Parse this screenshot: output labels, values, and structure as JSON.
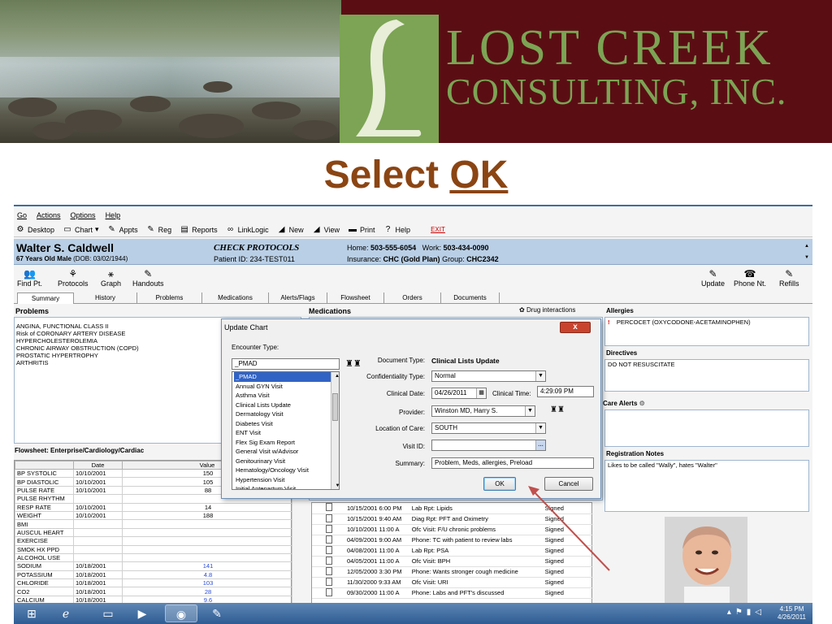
{
  "banner": {
    "brand_line1": "LOST CREEK",
    "brand_line2": "CONSULTING, INC."
  },
  "slide_title": {
    "prefix": "Select ",
    "emphasis": "OK"
  },
  "menu": [
    "Go",
    "Actions",
    "Options",
    "Help"
  ],
  "toolbar": [
    {
      "label": "Desktop",
      "icon": "desktop-icon",
      "glyph": "⚙"
    },
    {
      "label": "Chart",
      "icon": "folder-icon",
      "glyph": "▭"
    },
    {
      "label": "Appts",
      "icon": "calendar-icon",
      "glyph": "✎"
    },
    {
      "label": "Reg",
      "icon": "pen-icon",
      "glyph": "✎"
    },
    {
      "label": "Reports",
      "icon": "reports-icon",
      "glyph": "▤"
    },
    {
      "label": "LinkLogic",
      "icon": "link-icon",
      "glyph": "∞"
    },
    {
      "label": "New",
      "icon": "new-icon",
      "glyph": "◢"
    },
    {
      "label": "View",
      "icon": "view-icon",
      "glyph": "◢"
    },
    {
      "label": "Print",
      "icon": "printer-icon",
      "glyph": "▬"
    },
    {
      "label": "Help",
      "icon": "help-icon",
      "glyph": "?"
    },
    {
      "label": "EXIT",
      "icon": "exit-icon",
      "glyph": ""
    }
  ],
  "patient": {
    "name": "Walter S. Caldwell",
    "age_sex": "67 Years Old Male",
    "dob": "(DOB: 03/02/1944)",
    "check": "CHECK PROTOCOLS",
    "patient_id": "Patient ID: 234-TEST011",
    "home_label": "Home:",
    "home": "503-555-6054",
    "work_label": "Work:",
    "work": "503-434-0090",
    "insurance_label": "Insurance:",
    "insurance": "CHC (Gold Plan)",
    "group_label": "Group:",
    "group": "CHC2342"
  },
  "actions_left": [
    {
      "label": "Find Pt.",
      "icon": "find-patient-icon",
      "glyph": "👥"
    },
    {
      "label": "Protocols",
      "icon": "protocols-icon",
      "glyph": "⚘"
    },
    {
      "label": "Graph",
      "icon": "graph-icon",
      "glyph": "⚹"
    },
    {
      "label": "Handouts",
      "icon": "handouts-icon",
      "glyph": "✎"
    }
  ],
  "actions_right": [
    {
      "label": "Update",
      "icon": "update-icon",
      "glyph": "✎"
    },
    {
      "label": "Phone Nt.",
      "icon": "phone-note-icon",
      "glyph": "☎"
    },
    {
      "label": "Refills",
      "icon": "refills-icon",
      "glyph": "✎"
    }
  ],
  "tabs": [
    "Summary",
    "History",
    "Problems",
    "Medications",
    "Alerts/Flags",
    "Flowsheet",
    "Orders",
    "Documents"
  ],
  "problems": {
    "title": "Problems",
    "items": [
      "ANGINA, FUNCTIONAL CLASS II",
      "Risk of CORONARY ARTERY DISEASE",
      "HYPERCHOLESTEROLEMIA",
      "CHRONIC AIRWAY OBSTRUCTION (COPD)",
      "PROSTATIC HYPERTROPHY",
      "ARTHRITIS"
    ]
  },
  "medications": {
    "title": "Medications",
    "drug_interactions": "Drug interactions"
  },
  "allergies": {
    "title": "Allergies",
    "item": "PERCOCET (OXYCODONE-ACETAMINOPHEN)"
  },
  "directives": {
    "title": "Directives",
    "item": "DO NOT RESUSCITATE"
  },
  "care_alerts": {
    "title": "Care Alerts"
  },
  "registration": {
    "title": "Registration Notes",
    "note": "Likes to be called \"Wally\", hates \"Walter\""
  },
  "flowsheet": {
    "title": "Flowsheet: Enterprise/Cardiology/Cardiac",
    "headers": [
      "",
      "Date",
      "Value"
    ],
    "rows": [
      {
        "name": "BP SYSTOLIC",
        "date": "10/10/2001",
        "value": "150",
        "blue": false
      },
      {
        "name": "BP DIASTOLIC",
        "date": "10/10/2001",
        "value": "105",
        "blue": false
      },
      {
        "name": "PULSE RATE",
        "date": "10/10/2001",
        "value": "88",
        "blue": false
      },
      {
        "name": "PULSE RHYTHM",
        "date": "",
        "value": "",
        "blue": false
      },
      {
        "name": "RESP RATE",
        "date": "10/10/2001",
        "value": "14",
        "blue": false
      },
      {
        "name": "WEIGHT",
        "date": "10/10/2001",
        "value": "188",
        "blue": false
      },
      {
        "name": "BMI",
        "date": "",
        "value": "",
        "blue": false
      },
      {
        "name": "AUSCUL HEART",
        "date": "",
        "value": "",
        "blue": false
      },
      {
        "name": "EXERCISE",
        "date": "",
        "value": "",
        "blue": false
      },
      {
        "name": "SMOK HX PPD",
        "date": "",
        "value": "",
        "blue": false
      },
      {
        "name": "ALCOHOL USE",
        "date": "",
        "value": "",
        "blue": false
      },
      {
        "name": "SODIUM",
        "date": "10/18/2001",
        "value": "141",
        "blue": true
      },
      {
        "name": "POTASSIUM",
        "date": "10/18/2001",
        "value": "4.8",
        "blue": true
      },
      {
        "name": "CHLORIDE",
        "date": "10/18/2001",
        "value": "103",
        "blue": true
      },
      {
        "name": "CO2",
        "date": "10/18/2001",
        "value": "28",
        "blue": true
      },
      {
        "name": "CALCIUM",
        "date": "10/18/2001",
        "value": "9.6",
        "blue": true
      }
    ]
  },
  "encounters": [
    {
      "date": "10/15/2001 6:00 PM",
      "desc": "Lab Rpt: Lipids",
      "status": "Signed"
    },
    {
      "date": "10/15/2001 9:40 AM",
      "desc": "Diag Rpt: PFT and Oximetry",
      "status": "Signed"
    },
    {
      "date": "10/10/2001 11:00 A",
      "desc": "Ofc Visit: F/U chronic problems",
      "status": "Signed"
    },
    {
      "date": "04/09/2001 9:00 AM",
      "desc": "Phone: TC with patient to review labs",
      "status": "Signed"
    },
    {
      "date": "04/08/2001 11:00 A",
      "desc": "Lab Rpt: PSA",
      "status": "Signed"
    },
    {
      "date": "04/05/2001 11:00 A",
      "desc": "Ofc Visit: BPH",
      "status": "Signed"
    },
    {
      "date": "12/05/2000 3:30 PM",
      "desc": "Phone: Wants stronger cough medicine",
      "status": "Signed"
    },
    {
      "date": "11/30/2000 9:33 AM",
      "desc": "Ofc Visit: URI",
      "status": "Signed"
    },
    {
      "date": "09/30/2000 11:00 A",
      "desc": "Phone: Labs and PFT's discussed",
      "status": "Signed"
    }
  ],
  "dialog": {
    "title": "Update Chart",
    "encounter_label": "Encounter Type:",
    "encounter_value": "_PMAD",
    "encounter_options": [
      "_PMAD",
      "Annual GYN Visit",
      "Asthma Visit",
      "Clinical Lists Update",
      "Dermatology Visit",
      "Diabetes Visit",
      "ENT Visit",
      "Flex Sig Exam Report",
      "General Visit w/Advisor",
      "Genitourinary Visit",
      "Hematology/Oncology Visit",
      "Hypertension Visit",
      "Initial Antepartum Visit"
    ],
    "doc_type_label": "Document Type:",
    "doc_type_value": "Clinical Lists Update",
    "confidentiality_label": "Confidentiality Type:",
    "confidentiality_value": "Normal",
    "clinical_date_label": "Clinical Date:",
    "clinical_date_value": "04/26/2011",
    "clinical_time_label": "Clinical Time:",
    "clinical_time_value": "4:29:09 PM",
    "provider_label": "Provider:",
    "provider_value": "Winston MD, Harry S.",
    "location_label": "Location of Care:",
    "location_value": "SOUTH",
    "visit_id_label": "Visit ID:",
    "visit_id_value": "",
    "summary_label": "Summary:",
    "summary_value": "Problem, Meds, allergies, Preload",
    "ok": "OK",
    "cancel": "Cancel"
  },
  "taskbar": {
    "time": "4:15 PM",
    "date": "4/26/2011"
  },
  "colors": {
    "banner_maroon": "#5a0e14",
    "logo_green": "#7ca454",
    "title_brown": "#8b4513",
    "patient_bar": "#b9cfe5",
    "arrow": "#c0504d"
  }
}
